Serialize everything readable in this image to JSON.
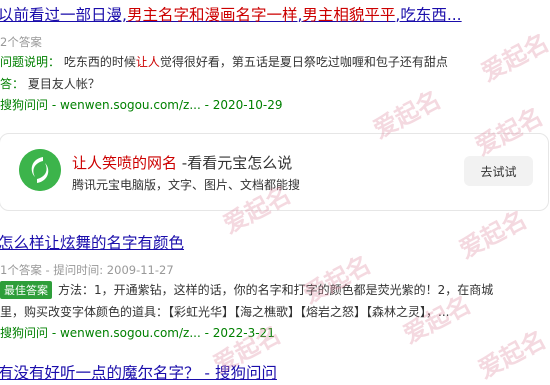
{
  "result1": {
    "title_parts": [
      "以前看过一部日漫,",
      "男主名字和漫画名字一样",
      ",",
      "男主相貌平平",
      ",吃东西..."
    ],
    "answer_count": "2个答案",
    "question_label": "问题说明：",
    "question_parts": [
      "吃东西的时候",
      "让人",
      "觉得很好看，第五话是夏日祭吃过咖喱和包子还有甜点"
    ],
    "answer_label": "答：",
    "answer_text": "夏目友人帐？",
    "source": "搜狗问问 - wenwen.sogou.com/z... - 2020-10-29"
  },
  "ad_card": {
    "title_hl": "让人笑喷的网名",
    "title_rest": " -看看元宝怎么说",
    "subtitle": "腾讯元宝电脑版，文字、图片、文档都能搜",
    "button": "去试试",
    "logo_icon": "yuanbao-logo-icon"
  },
  "result2": {
    "title": "怎么样让炫舞的名字有颜色",
    "meta": "1个答案 - 提问时间: 2009-11-27",
    "badge": "最佳答案",
    "answer_line1": "方法：1，开通紫钻，这样的话，你的名字和打字的颜色都是荧光紫的！2，在商城",
    "answer_line2": "里，购买改变字体颜色的道具：【彩虹光华】【海之樵歌】【熔岩之怒】【森林之灵】，...",
    "source": "搜狗问问 - wenwen.sogou.com/z... - 2022-3-21"
  },
  "result3": {
    "title": "有没有好听一点的魔尔名字？ - 搜狗问问"
  },
  "watermark": "爱起名",
  "colors": {
    "link": "#1a0dab",
    "highlight": "#cc0000",
    "source_green": "#008000",
    "badge_green": "#2e9e3a"
  }
}
